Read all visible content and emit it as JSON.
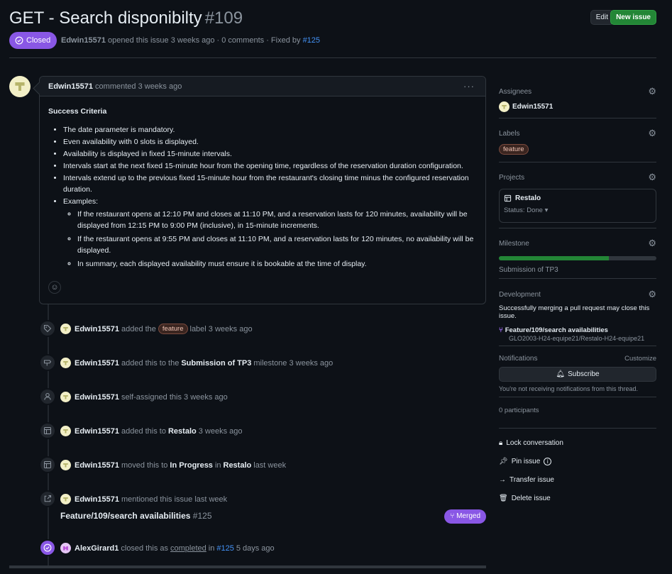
{
  "issue": {
    "title": "GET - Search disponibilty",
    "number": "#109",
    "state": "Closed",
    "author": "Edwin15571",
    "meta_text": " opened this issue 3 weeks ago · 0 comments · Fixed by ",
    "fixed_by": "#125"
  },
  "header": {
    "edit_label": "Edit",
    "new_issue_label": "New issue"
  },
  "comment": {
    "author": "Edwin15571",
    "action": "commented 3 weeks ago",
    "heading": "Success Criteria",
    "items": [
      "The date parameter is mandatory.",
      "Even availability with 0 slots is displayed.",
      "Availability is displayed in fixed 15-minute intervals.",
      "Intervals start at the next fixed 15-minute hour from the opening time, regardless of the reservation duration configuration.",
      "Intervals extend up to the previous fixed 15-minute hour from the restaurant's closing time minus the configured reservation duration.",
      "Examples:"
    ],
    "sub_items": [
      "If the restaurant opens at 12:10 PM and closes at 11:10 PM, and a reservation lasts for 120 minutes, availability will be displayed from 12:15 PM to 9:00 PM (inclusive), in 15-minute increments.",
      "If the restaurant opens at 9:55 PM and closes at 11:10 PM, and a reservation lasts for 120 minutes, no availability will be displayed.",
      "In summary, each displayed availability must ensure it is bookable at the time of display."
    ]
  },
  "timeline": {
    "e1": {
      "user": "Edwin15571",
      "a": "added the",
      "label": "feature",
      "b": "label 3 weeks ago"
    },
    "e2": {
      "user": "Edwin15571",
      "a": "added this to the",
      "target": "Submission of TP3",
      "b": "milestone 3 weeks ago"
    },
    "e3": {
      "user": "Edwin15571",
      "a": "self-assigned this 3 weeks ago"
    },
    "e4": {
      "user": "Edwin15571",
      "a": "added this to",
      "target": "Restalo",
      "b": "3 weeks ago"
    },
    "e5": {
      "user": "Edwin15571",
      "a": "moved this to",
      "target": "In Progress",
      "mid": "in",
      "target2": "Restalo",
      "b": "last week"
    },
    "e6": {
      "user": "Edwin15571",
      "a": "mentioned this issue last week",
      "ref_title": "Feature/109/search availabilities",
      "ref_num": "#125",
      "merged": "Merged"
    },
    "e7": {
      "user": "AlexGirard1",
      "a": "closed this as",
      "completed": "completed",
      "mid": "in",
      "ref": "#125",
      "b": "5 days ago"
    }
  },
  "sidebar": {
    "assignees": {
      "title": "Assignees",
      "user": "Edwin15571"
    },
    "labels": {
      "title": "Labels",
      "label": "feature"
    },
    "projects": {
      "title": "Projects",
      "name": "Restalo",
      "status": "Status: Done"
    },
    "milestone": {
      "title": "Milestone",
      "name": "Submission of TP3",
      "progress": 0.7
    },
    "development": {
      "title": "Development",
      "note": "Successfully merging a pull request may close this issue.",
      "pr_title": "Feature/109/search availabilities",
      "repo": "GLO2003-H24-equipe21/Restalo-H24-equipe21"
    },
    "notifications": {
      "title": "Notifications",
      "customize": "Customize",
      "subscribe": "Subscribe",
      "note": "You're not receiving notifications from this thread."
    },
    "participants": "0 participants",
    "actions": {
      "lock": "Lock conversation",
      "pin": "Pin issue",
      "transfer": "Transfer issue",
      "delete": "Delete issue"
    }
  },
  "colors": {
    "closed": "#8957e5",
    "accent": "#4493f8",
    "green": "#238636",
    "bg": "#0d1117"
  }
}
